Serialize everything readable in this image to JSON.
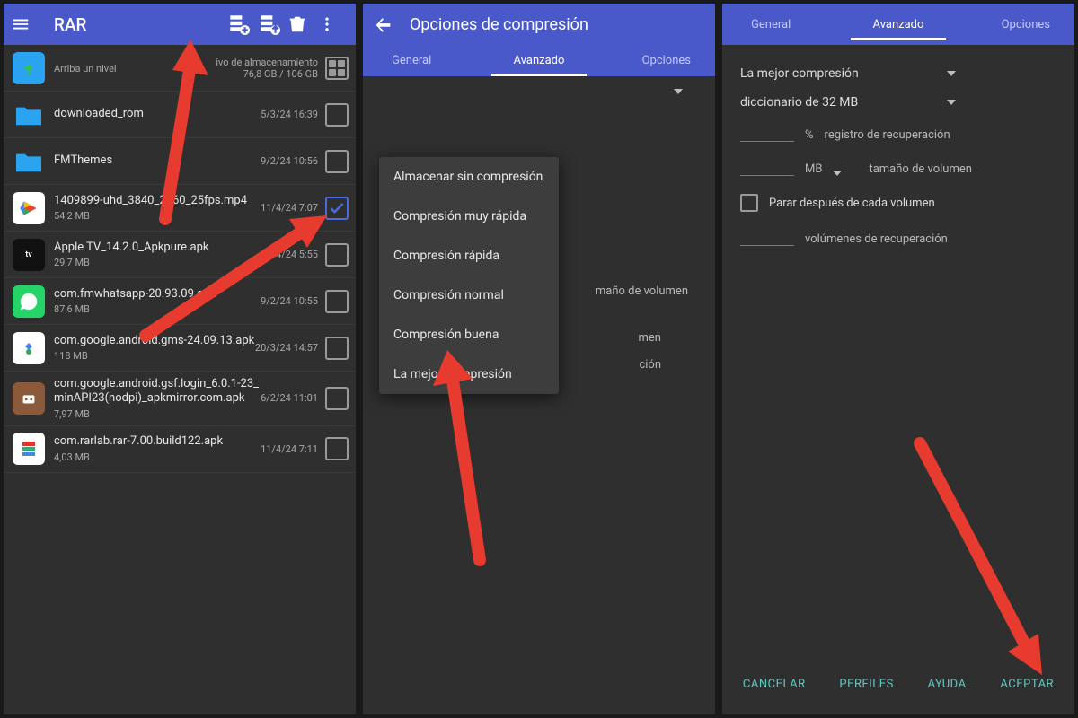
{
  "panel1": {
    "app_title": "RAR",
    "storage_label": "ivo de almacenamiento",
    "storage_usage": "76,8 GB / 106 GB",
    "up_label": "Arriba un nivel",
    "files": [
      {
        "name": "downloaded_rom",
        "sub": "",
        "date": "5/3/24 16:39",
        "type": "folder",
        "checked": false
      },
      {
        "name": "FMThemes",
        "sub": "",
        "date": "9/2/24 10:56",
        "type": "folder",
        "checked": false
      },
      {
        "name": "1409899-uhd_3840_2160_25fps.mp4",
        "sub": "54,2 MB",
        "date": "11/4/24 7:07",
        "type": "play",
        "checked": true
      },
      {
        "name": "Apple TV_14.2.0_Apkpure.apk",
        "sub": "29,7 MB",
        "date": "11/4/24 5:55",
        "type": "appletv",
        "checked": false
      },
      {
        "name": "com.fmwhatsapp-20.93.09.apk",
        "sub": "87,6 MB",
        "date": "9/2/24 10:55",
        "type": "whatsapp",
        "checked": false
      },
      {
        "name": "com.google.android.gms-24.09.13.apk",
        "sub": "118 MB",
        "date": "20/3/24 14:57",
        "type": "gms",
        "checked": false
      },
      {
        "name": "com.google.android.gsf.login_6.0.1-23_minAPI23(nodpi)_apkmirror.com.apk",
        "sub": "7,97 MB",
        "date": "6/2/24 11:01",
        "type": "gsf",
        "checked": false
      },
      {
        "name": "com.rarlab.rar-7.00.build122.apk",
        "sub": "4,03 MB",
        "date": "11/4/24 7:11",
        "type": "rar",
        "checked": false
      }
    ]
  },
  "panel2": {
    "header": "Opciones de compresión",
    "tabs": {
      "left": "General",
      "center": "Avanzado",
      "right": "Opciones"
    },
    "dropdown_options": [
      "Almacenar sin compresión",
      "Compresión muy rápida",
      "Compresión rápida",
      "Compresión normal",
      "Compresión buena",
      "La mejor compresión"
    ],
    "ghost_volsize": "maño de volumen",
    "ghost_men": "men",
    "ghost_cion": "ción"
  },
  "panel3": {
    "tabs": {
      "left": "General",
      "center": "Avanzado",
      "right": "Opciones"
    },
    "compression_value": "La mejor compresión",
    "dictionary_value": "diccionario de 32 MB",
    "pct": "%",
    "recovery_label": "registro de recuperación",
    "mb_unit": "MB",
    "volsize_label": "tamaño de volumen",
    "stop_each_volume": "Parar después de cada volumen",
    "recovery_volumes": "volúmenes de recuperación",
    "buttons": {
      "cancel": "CANCELAR",
      "profiles": "PERFILES",
      "help": "AYUDA",
      "ok": "ACEPTAR"
    }
  }
}
